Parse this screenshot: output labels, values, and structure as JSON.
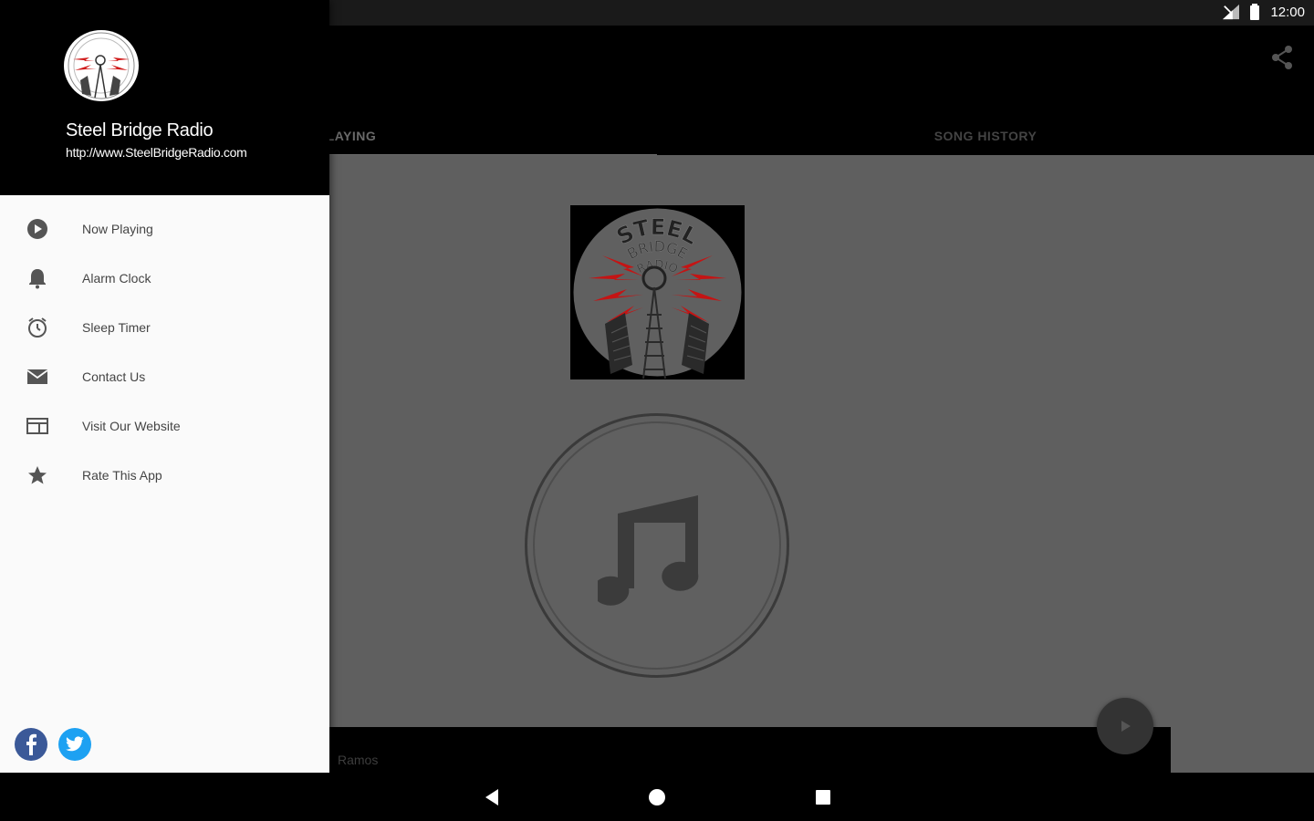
{
  "status_bar": {
    "time": "12:00",
    "left_icons": [
      "play-icon",
      "sync-icon",
      "sd-card-icon"
    ],
    "right_icons": [
      "signal-icon",
      "battery-icon"
    ]
  },
  "drawer": {
    "station_name": "Steel Bridge Radio",
    "station_url": "http://www.SteelBridgeRadio.com",
    "menu_items": [
      {
        "label": "Now Playing",
        "icon": "play-circle-icon"
      },
      {
        "label": "Alarm Clock",
        "icon": "bell-icon"
      },
      {
        "label": "Sleep Timer",
        "icon": "alarm-clock-icon"
      },
      {
        "label": "Contact Us",
        "icon": "mail-icon"
      },
      {
        "label": "Visit Our Website",
        "icon": "web-icon"
      },
      {
        "label": "Rate This App",
        "icon": "star-icon"
      }
    ],
    "social": [
      {
        "name": "facebook",
        "label": "f",
        "color": "#3b5998"
      },
      {
        "name": "twitter",
        "color": "#1da1f2"
      }
    ]
  },
  "tabs": [
    {
      "label": "NOW PLAYING",
      "visible_label": "LAYING",
      "active": true
    },
    {
      "label": "SONG HISTORY",
      "active": false
    }
  ],
  "logo_text": {
    "line1": "STEEL",
    "line2": "BRIDGE",
    "line3": "RADIO"
  },
  "player": {
    "artist_partial": "Ramos"
  },
  "colors": {
    "content_bg": "#5f5f5f",
    "accent_red": "#d01818",
    "drawer_bg": "#fafafa"
  }
}
